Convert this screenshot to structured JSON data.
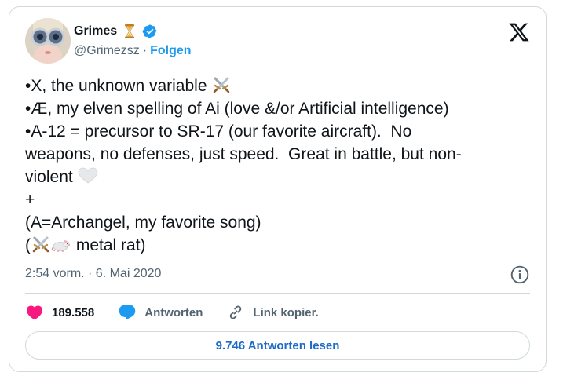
{
  "author": {
    "display_name": "Grimes",
    "handle": "@Grimezsz",
    "separator": "·",
    "follow_label": "Folgen",
    "verified": true
  },
  "tweet": {
    "lines": [
      "•X, the unknown variable",
      "•Æ, my elven spelling of Ai (love &/or Artificial intelligence)",
      "•A-12 = precursor to SR-17 (our favorite aircraft).  No",
      "weapons, no defenses, just speed.  Great in battle, but non-",
      "violent",
      "+",
      "(A=Archangel, my favorite song)",
      "(",
      " metal rat)"
    ],
    "timestamp": "2:54 vorm. · 6. Mai 2020"
  },
  "actions": {
    "like_count": "189.558",
    "reply_label": "Antworten",
    "copy_link_label": "Link kopier."
  },
  "read_replies_label": "9.746 Antworten lesen",
  "icons": {
    "brand": "x-logo-icon",
    "verified": "verified-badge-icon",
    "hourglass": "hourglass-icon",
    "info": "info-icon",
    "like": "heart-icon",
    "reply": "speech-bubble-icon",
    "link": "link-icon",
    "swords_emoji": "crossed-swords-emoji",
    "heart_emoji": "white-heart-emoji",
    "rat_emoji": "rat-emoji"
  },
  "colors": {
    "accent": "#1d9bf0",
    "like": "#f91880",
    "text": "#0f1419",
    "muted": "#536471",
    "border": "#cfd9de",
    "link_button": "#1d6ac9"
  }
}
